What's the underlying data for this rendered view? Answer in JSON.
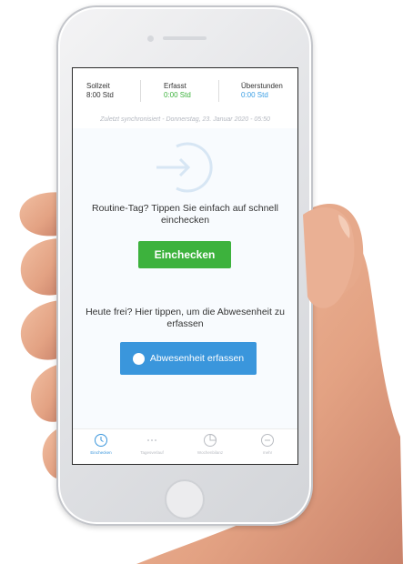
{
  "stats": {
    "sollzeit": {
      "label": "Sollzeit",
      "value": "8:00 Std"
    },
    "erfasst": {
      "label": "Erfasst",
      "value": "0:00 Std"
    },
    "ueberstunden": {
      "label": "Überstunden",
      "value": "0:00 Std"
    }
  },
  "sync": {
    "text": "Zuletzt synchronisiert - Donnerstag, 23. Januar 2020 - 05:50"
  },
  "routine": {
    "text": "Routine-Tag? Tippen Sie einfach auf schnell einchecken"
  },
  "checkin": {
    "label": "Einchecken"
  },
  "free": {
    "text": "Heute frei? Hier tippen, um die Abwesenheit zu erfassen"
  },
  "absence": {
    "label": "Abwesenheit erfassen"
  },
  "tabs": [
    {
      "label": "Einchecken",
      "icon": "clock-icon",
      "active": true
    },
    {
      "label": "Tagesverlauf",
      "icon": "timeline-icon",
      "active": false
    },
    {
      "label": "Wochenbilanz",
      "icon": "pie-chart-icon",
      "active": false
    },
    {
      "label": "mehr",
      "icon": "more-icon",
      "active": false
    }
  ],
  "colors": {
    "green": "#3db23d",
    "blue": "#3a96dc",
    "skin": "#e8a98a"
  }
}
